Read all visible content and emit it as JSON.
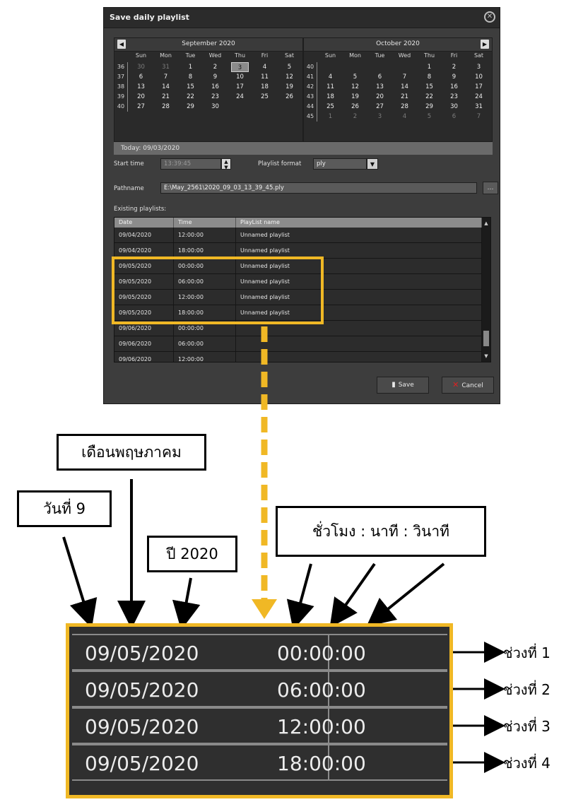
{
  "dialog": {
    "title": "Save daily playlist",
    "calendar_left": {
      "month": "September 2020",
      "days": [
        "Sun",
        "Mon",
        "Tue",
        "Wed",
        "Thu",
        "Fri",
        "Sat"
      ],
      "weeks": [
        "36",
        "37",
        "38",
        "39",
        "40"
      ],
      "rows": [
        [
          "30",
          "31",
          "1",
          "2",
          "3",
          "4",
          "5"
        ],
        [
          "6",
          "7",
          "8",
          "9",
          "10",
          "11",
          "12"
        ],
        [
          "13",
          "14",
          "15",
          "16",
          "17",
          "18",
          "19"
        ],
        [
          "20",
          "21",
          "22",
          "23",
          "24",
          "25",
          "26"
        ],
        [
          "27",
          "28",
          "29",
          "30",
          "",
          "",
          ""
        ]
      ],
      "selected": "3"
    },
    "calendar_right": {
      "month": "October 2020",
      "days": [
        "Sun",
        "Mon",
        "Tue",
        "Wed",
        "Thu",
        "Fri",
        "Sat"
      ],
      "weeks": [
        "40",
        "41",
        "42",
        "43",
        "44",
        "45"
      ],
      "rows": [
        [
          "",
          "",
          "",
          "",
          "1",
          "2",
          "3"
        ],
        [
          "4",
          "5",
          "6",
          "7",
          "8",
          "9",
          "10"
        ],
        [
          "11",
          "12",
          "13",
          "14",
          "15",
          "16",
          "17"
        ],
        [
          "18",
          "19",
          "20",
          "21",
          "22",
          "23",
          "24"
        ],
        [
          "25",
          "26",
          "27",
          "28",
          "29",
          "30",
          "31"
        ],
        [
          "1",
          "2",
          "3",
          "4",
          "5",
          "6",
          "7"
        ]
      ]
    },
    "today": "Today: 09/03/2020",
    "start_time_label": "Start time",
    "start_time_value": "13:39:45",
    "playlist_format_label": "Playlist format",
    "playlist_format_value": "ply",
    "pathname_label": "Pathname",
    "pathname_value": "E:\\May_2561\\2020_09_03_13_39_45.ply",
    "existing_label": "Existing playlists:",
    "columns": [
      "Date",
      "Time",
      "PlayList name"
    ],
    "rows": [
      [
        "09/04/2020",
        "12:00:00",
        "Unnamed playlist"
      ],
      [
        "09/04/2020",
        "18:00:00",
        "Unnamed playlist"
      ],
      [
        "09/05/2020",
        "00:00:00",
        "Unnamed playlist"
      ],
      [
        "09/05/2020",
        "06:00:00",
        "Unnamed playlist"
      ],
      [
        "09/05/2020",
        "12:00:00",
        "Unnamed playlist"
      ],
      [
        "09/05/2020",
        "18:00:00",
        "Unnamed playlist"
      ],
      [
        "09/06/2020",
        "00:00:00",
        ""
      ],
      [
        "09/06/2020",
        "06:00:00",
        ""
      ],
      [
        "09/06/2020",
        "12:00:00",
        ""
      ]
    ],
    "save_label": "Save",
    "cancel_label": "Cancel"
  },
  "annotations": {
    "month": "เดือนพฤษภาคม",
    "day": "วันที่ 9",
    "year": "ปี 2020",
    "time_format": "ชั่วโมง : นาที : วินาที",
    "zoom_rows": [
      [
        "09/05/2020",
        "00:00:00"
      ],
      [
        "09/05/2020",
        "06:00:00"
      ],
      [
        "09/05/2020",
        "12:00:00"
      ],
      [
        "09/05/2020",
        "18:00:00"
      ]
    ],
    "periods": [
      "ช่วงที่ 1",
      "ช่วงที่ 2",
      "ช่วงที่ 3",
      "ช่วงที่ 4"
    ]
  },
  "colors": {
    "highlight": "#f0b825",
    "dialog_bg": "#3d3d3d"
  }
}
